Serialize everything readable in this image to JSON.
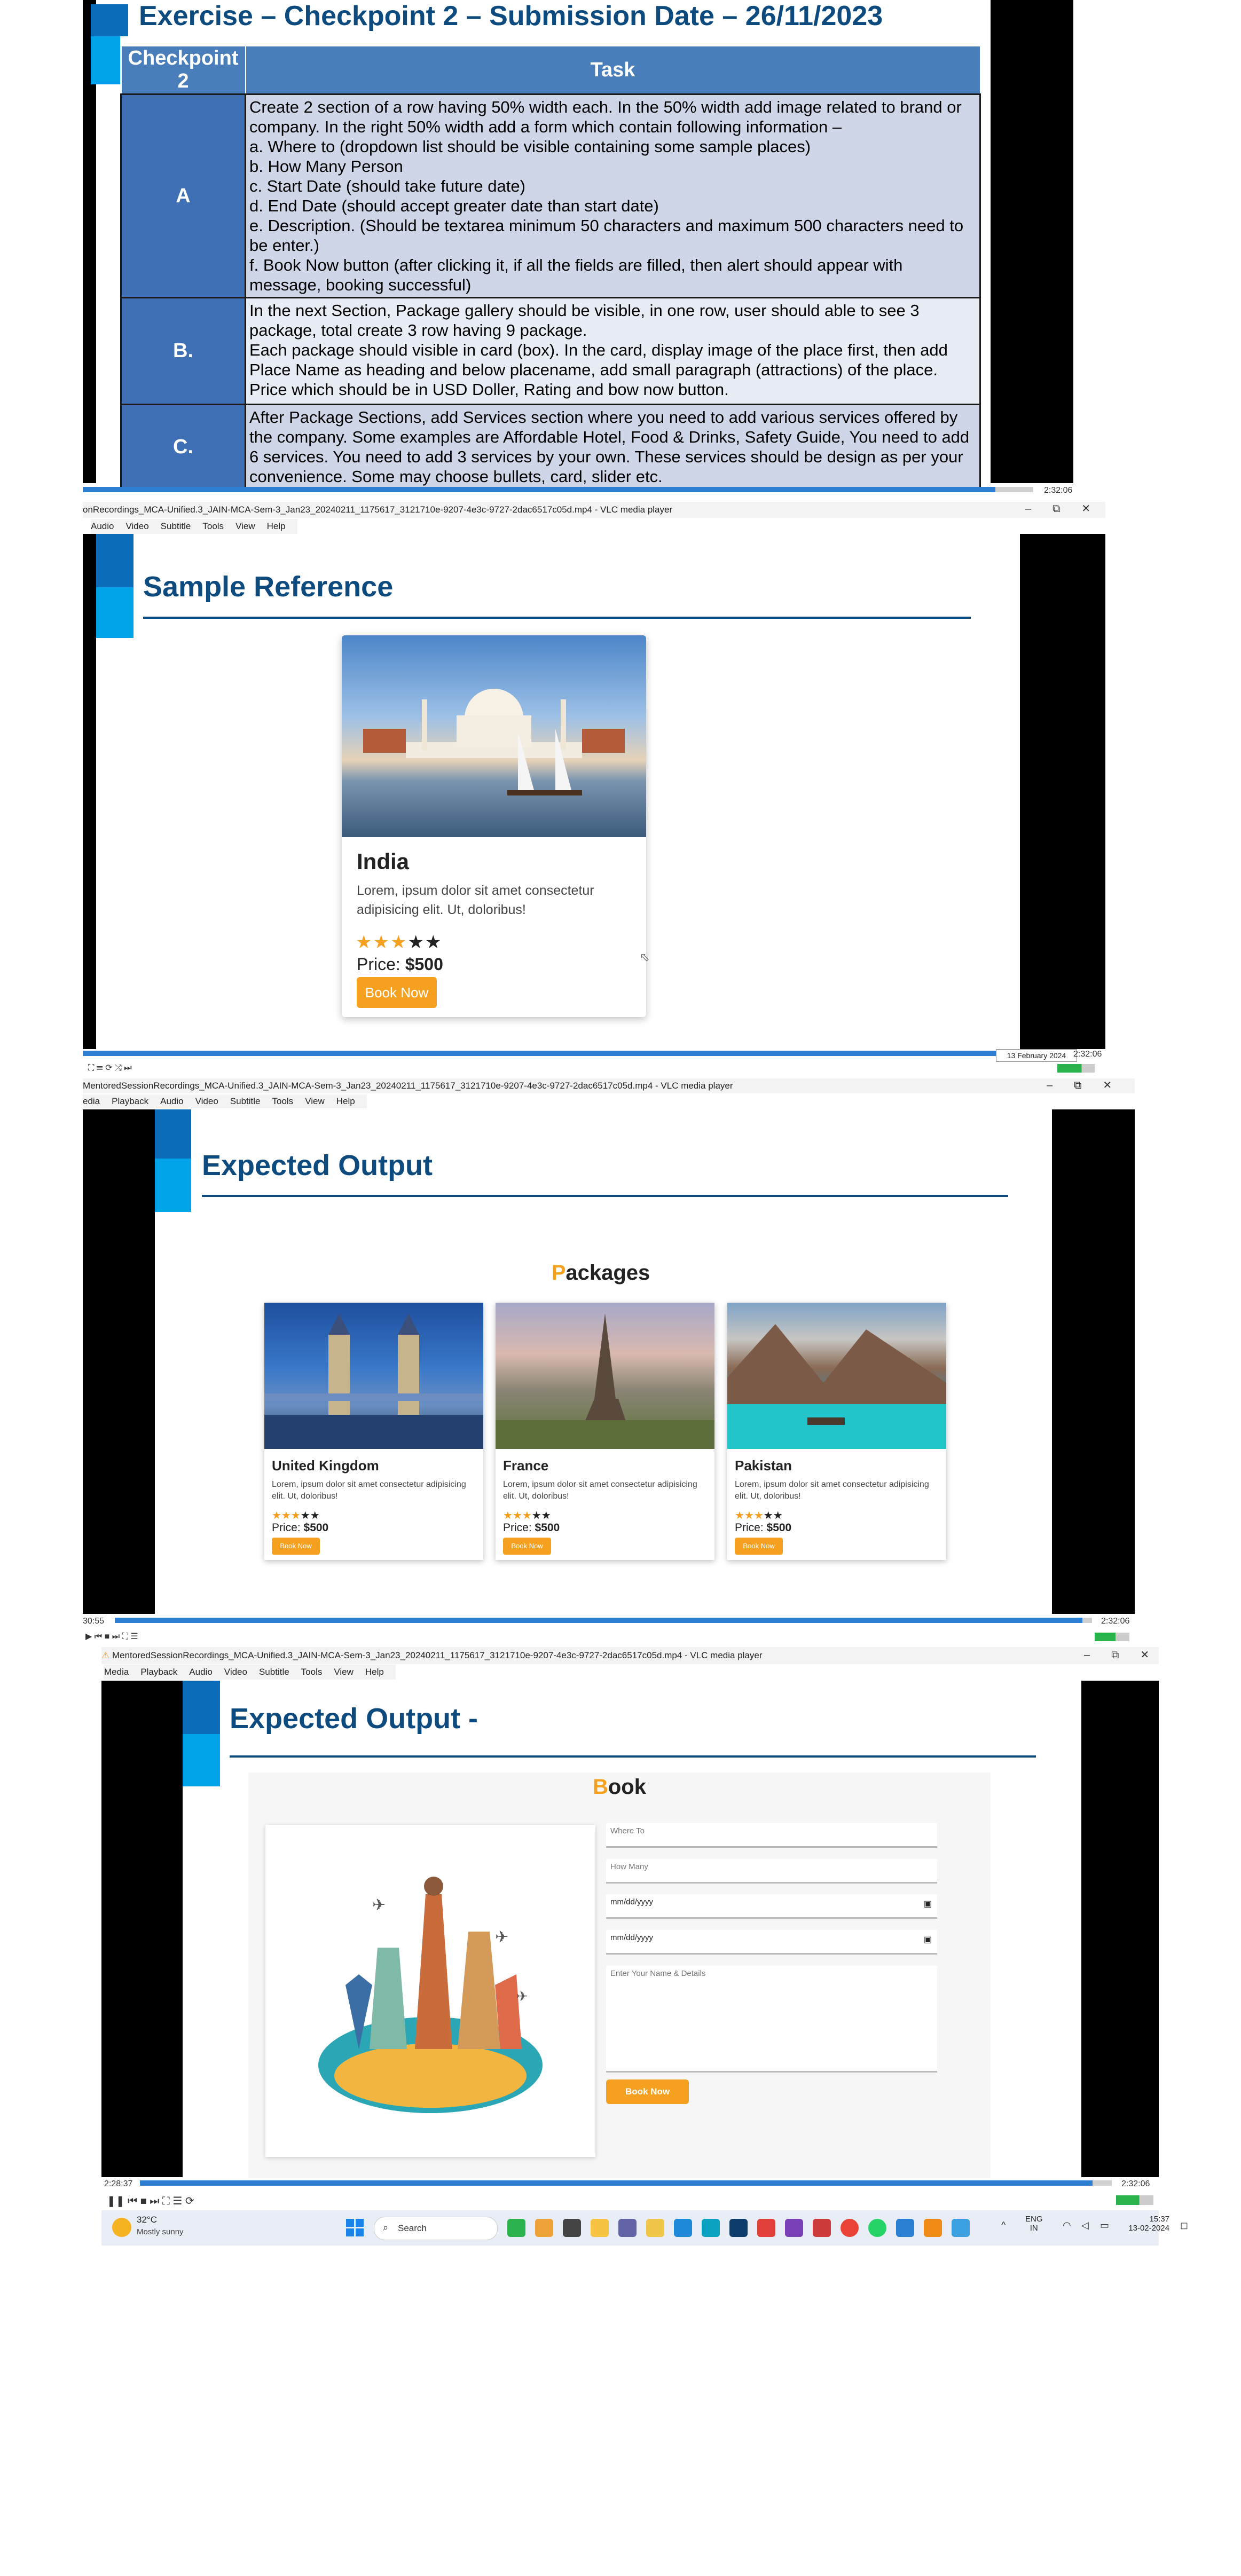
{
  "frame1": {
    "title": "Exercise – Checkpoint 2 – Submission Date – 26/11/2023",
    "table_headers": [
      "Checkpoint 2",
      "Task"
    ],
    "rows": [
      {
        "label": "A",
        "text": "Create 2 section of a row having 50% width each. In the 50% width add image related to brand or company. In the right 50% width add a form which contain following information –\na. Where to (dropdown list should be visible containing some sample places)\nb. How Many Person\nc. Start Date (should take future date)\nd. End Date (should accept greater date than start date)\ne. Description. (Should be textarea minimum 50 characters and maximum 500 characters need to be enter.)\nf. Book Now button (after clicking it, if all the fields are filled, then alert should appear with message, booking successful)"
      },
      {
        "label": "B.",
        "text": "In the next Section, Package gallery should be visible, in one row, user should able to see 3 package, total create 3 row having 9 package.\nEach package should visible in card (box). In the card, display image of the place first, then add Place Name as heading and below placename, add small paragraph (attractions) of the place. Price which should be in USD Doller, Rating and bow now button."
      },
      {
        "label": "C.",
        "text": "After Package Sections, add Services section where you need to add various services offered by the company. Some examples are Affordable Hotel, Food & Drinks, Safety Guide, You need to add 6 services. You need to add 3 services by your own. These services should be design as per your convenience. Some may choose bullets, card, slider etc."
      }
    ],
    "time_right": "2:32:06"
  },
  "frame2": {
    "window_title": "onRecordings_MCA-Unified.3_JAIN-MCA-Sem-3_Jan23_20240211_1175617_3121710e-9207-4e3c-9727-2dac6517c05d.mp4 - VLC media player",
    "menu": [
      "Audio",
      "Video",
      "Subtitle",
      "Tools",
      "View",
      "Help"
    ],
    "heading": "Sample Reference",
    "card": {
      "title": "India",
      "text": "Lorem, ipsum dolor sit amet consectetur adipisicing elit. Ut, doloribus!",
      "rating": 3,
      "price_label": "Price: ",
      "price_value": "$500",
      "button": "Book Now"
    },
    "date_badge": "13 February 2024",
    "time_right": "2:32:06"
  },
  "frame3": {
    "window_title": "MentoredSessionRecordings_MCA-Unified.3_JAIN-MCA-Sem-3_Jan23_20240211_1175617_3121710e-9207-4e3c-9727-2dac6517c05d.mp4 - VLC media player",
    "menu": [
      "edia",
      "Playback",
      "Audio",
      "Video",
      "Subtitle",
      "Tools",
      "View",
      "Help"
    ],
    "heading": "Expected Output",
    "packages_title_first": "P",
    "packages_title_rest": "ackages",
    "cards": [
      {
        "title": "United Kingdom",
        "text": "Lorem, ipsum dolor sit amet consectetur adipisicing elit. Ut, doloribus!",
        "rating": 3,
        "price_label": "Price: ",
        "price_value": "$500",
        "button": "Book Now"
      },
      {
        "title": "France",
        "text": "Lorem, ipsum dolor sit amet consectetur adipisicing elit. Ut, doloribus!",
        "rating": 3,
        "price_label": "Price: ",
        "price_value": "$500",
        "button": "Book Now"
      },
      {
        "title": "Pakistan",
        "text": "Lorem, ipsum dolor sit amet consectetur adipisicing elit. Ut, doloribus!",
        "rating": 3,
        "price_label": "Price: ",
        "price_value": "$500",
        "button": "Book Now"
      }
    ],
    "time_left": "30:55",
    "time_right": "2:32:06"
  },
  "frame4": {
    "window_title": "MentoredSessionRecordings_MCA-Unified.3_JAIN-MCA-Sem-3_Jan23_20240211_1175617_3121710e-9207-4e3c-9727-2dac6517c05d.mp4 - VLC media player",
    "menu": [
      "Media",
      "Playback",
      "Audio",
      "Video",
      "Subtitle",
      "Tools",
      "View",
      "Help"
    ],
    "heading": "Expected Output -",
    "book_title_first": "B",
    "book_title_rest": "ook",
    "form": {
      "where_placeholder": "Where To",
      "how_many_placeholder": "How Many",
      "start_date": "mm/dd/yyyy",
      "end_date": "mm/dd/yyyy",
      "details_placeholder": "Enter Your Name & Details",
      "button": "Book Now"
    },
    "time_left": "2:28:37",
    "time_right": "2:32:06"
  },
  "taskbar": {
    "weather_temp": "32°C",
    "weather_desc": "Mostly sunny",
    "search": "Search",
    "lang1": "ENG",
    "lang2": "IN",
    "time": "15:37",
    "date": "13-02-2024"
  },
  "colors": {
    "accent": "#f6a020",
    "heading": "#0d4a7e",
    "table_label": "#3f6fb5"
  }
}
